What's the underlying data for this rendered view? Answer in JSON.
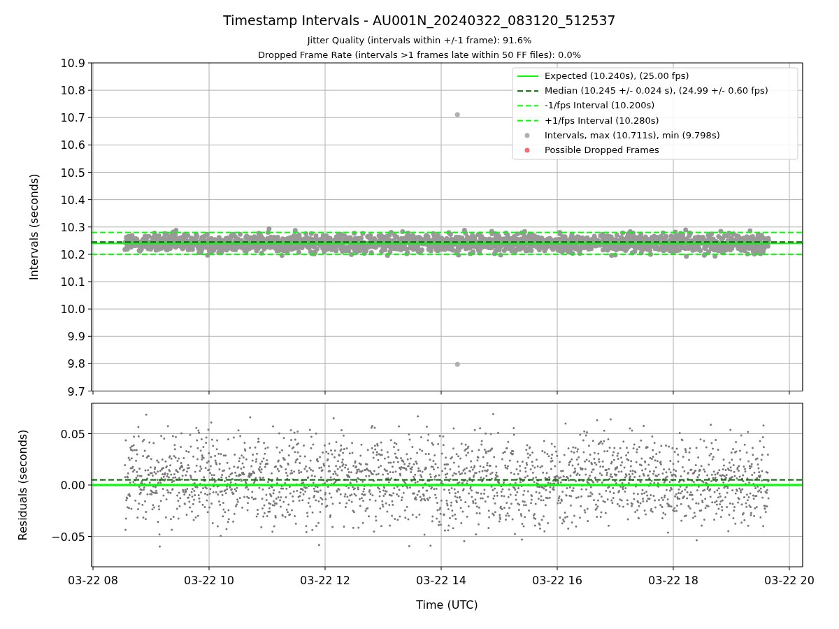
{
  "charts": [
    {
      "title": "Timestamp Intervals - AU001N_20240322_083120_512537",
      "subtitles": [
        "Jitter Quality (intervals within +/-1 frame): 91.6%",
        "Dropped Frame Rate (intervals >1 frames late within 50 FF files): 0.0%"
      ],
      "ylabel": "Intervals (seconds)",
      "y_ticks": [
        "10.9",
        "10.8",
        "10.7",
        "10.6",
        "10.5",
        "10.4",
        "10.3",
        "10.2",
        "10.1",
        "10.0",
        "9.9",
        "9.8",
        "9.7"
      ],
      "legend": [
        {
          "label": "Expected (10.240s), (25.00 fps)",
          "kind": "solid",
          "color": "#00ff00"
        },
        {
          "label": "Median (10.245 +/- 0.024 s), (24.99 +/- 0.60 fps)",
          "kind": "dashed",
          "color": "#006400"
        },
        {
          "label": "-1/fps Interval (10.200s)",
          "kind": "dashed",
          "color": "#00ff00"
        },
        {
          "label": "+1/fps Interval (10.280s)",
          "kind": "dashed",
          "color": "#00ff00"
        },
        {
          "label": "Intervals, max (10.711s), min (9.798s)",
          "kind": "marker",
          "color": "#b0b0b0"
        },
        {
          "label": "Possible Dropped Frames",
          "kind": "marker",
          "color": "#f07070"
        }
      ]
    },
    {
      "ylabel": "Residuals (seconds)",
      "xlabel": "Time (UTC)",
      "y_ticks": [
        "0.05",
        "0.00",
        "−0.05"
      ],
      "x_ticks": [
        "03-22 08",
        "03-22 10",
        "03-22 12",
        "03-22 14",
        "03-22 16",
        "03-22 18",
        "03-22 20"
      ]
    }
  ]
}
